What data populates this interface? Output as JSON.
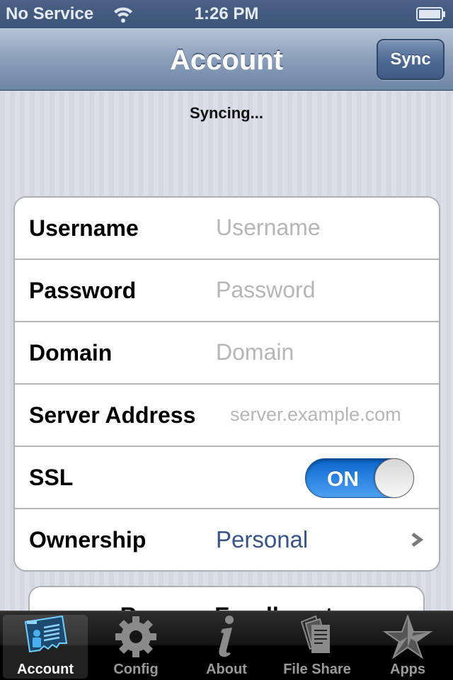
{
  "status_bar": {
    "carrier": "No Service",
    "time": "1:26 PM",
    "wifi_icon": "wifi-icon",
    "battery_icon": "battery-icon"
  },
  "nav_bar": {
    "title": "Account",
    "sync_button_label": "Sync"
  },
  "sync_status": "Syncing...",
  "form": {
    "rows": [
      {
        "label": "Username",
        "type": "text",
        "value": "",
        "placeholder": "Username"
      },
      {
        "label": "Password",
        "type": "password",
        "value": "",
        "placeholder": "Password"
      },
      {
        "label": "Domain",
        "type": "text",
        "value": "",
        "placeholder": "Domain"
      },
      {
        "label": "Server Address",
        "type": "text",
        "value": "",
        "placeholder": "server.example.com"
      },
      {
        "label": "SSL",
        "type": "toggle",
        "state": "ON"
      },
      {
        "label": "Ownership",
        "type": "disclosure",
        "value": "Personal"
      }
    ]
  },
  "enrollment_button": {
    "label": "Remove Enrollment"
  },
  "tab_bar": {
    "active": "Account",
    "tabs": [
      {
        "label": "Account",
        "icon": "account-card-icon"
      },
      {
        "label": "Config",
        "icon": "gear-icon"
      },
      {
        "label": "About",
        "icon": "info-icon"
      },
      {
        "label": "File Share",
        "icon": "documents-icon"
      },
      {
        "label": "Apps",
        "icon": "star-icon"
      }
    ]
  },
  "colors": {
    "accent_blue": "#385487",
    "toggle_on": "#2b84e2",
    "nav_bar": "#6d85a6",
    "status_bar": "#3c5477"
  }
}
